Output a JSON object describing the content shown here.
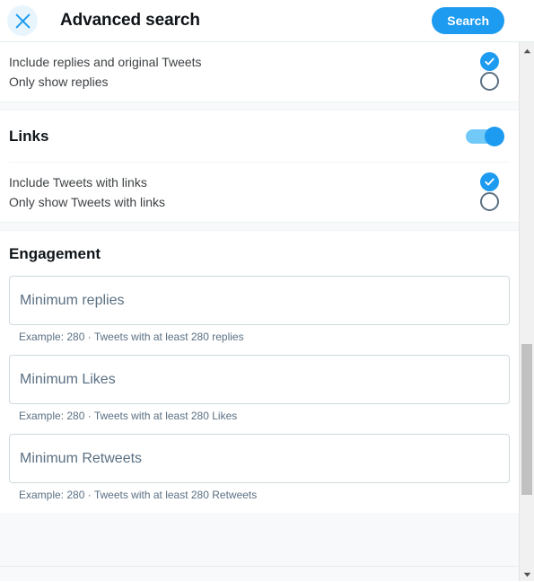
{
  "header": {
    "close_icon": "close-x-icon",
    "title": "Advanced search",
    "search_label": "Search"
  },
  "sections": {
    "replies": {
      "options": [
        {
          "label": "Include replies and original Tweets",
          "state": "checked"
        },
        {
          "label": "Only show replies",
          "state": "unchecked"
        }
      ]
    },
    "links": {
      "title": "Links",
      "toggle_state": "on",
      "options": [
        {
          "label": "Include Tweets with links",
          "state": "checked"
        },
        {
          "label": "Only show Tweets with links",
          "state": "unchecked"
        }
      ]
    },
    "engagement": {
      "title": "Engagement",
      "fields": [
        {
          "placeholder": "Minimum replies",
          "value": "",
          "hint": "Example: 280 · Tweets with at least 280 replies"
        },
        {
          "placeholder": "Minimum Likes",
          "value": "",
          "hint": "Example: 280 · Tweets with at least 280 Likes"
        },
        {
          "placeholder": "Minimum Retweets",
          "value": "",
          "hint": "Example: 280 · Tweets with at least 280 Retweets"
        }
      ]
    }
  },
  "scrollbar": {
    "up_arrow_icon": "chevron-up-icon",
    "down_arrow_icon": "chevron-down-icon"
  },
  "colors": {
    "accent": "#1d9bf0",
    "accent_track": "#71c9f8",
    "accent_soft": "#e8f5fd",
    "text_primary": "#0f1419",
    "text_secondary": "#5b7083",
    "border": "#cfd9de",
    "divider": "#eff3f4",
    "page_bg": "#f7f9fa"
  }
}
